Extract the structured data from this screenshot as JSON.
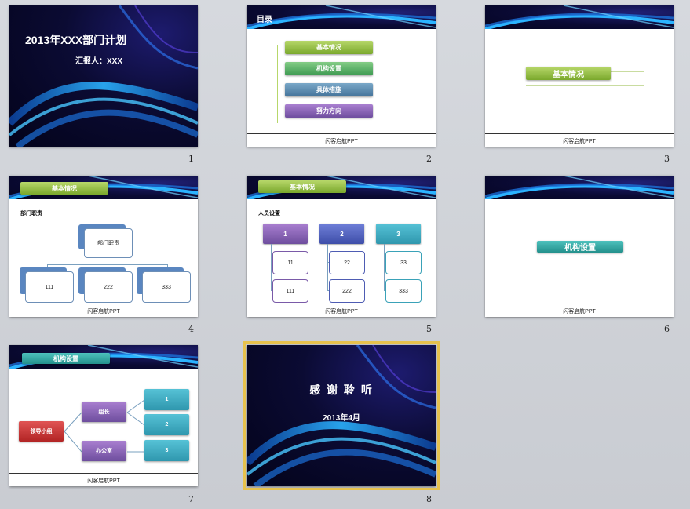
{
  "slides": [
    {
      "number": "1",
      "title": "2013年XXX部门计划",
      "subtitle": "汇报人：XXX"
    },
    {
      "number": "2",
      "title": "目录",
      "items": [
        "基本情况",
        "机构设置",
        "具体措施",
        "努力方向"
      ],
      "footer": "闪客启航PPT"
    },
    {
      "number": "3",
      "section": "基本情况",
      "footer": "闪客启航PPT"
    },
    {
      "number": "4",
      "header": "基本情况",
      "label": "部门职责",
      "root": "部门职责",
      "children": [
        "111",
        "222",
        "333"
      ],
      "footer": "闪客启航PPT"
    },
    {
      "number": "5",
      "header": "基本情况",
      "label": "人员设置",
      "columns": [
        {
          "head": "1",
          "items": [
            "11",
            "111"
          ]
        },
        {
          "head": "2",
          "items": [
            "22",
            "222"
          ]
        },
        {
          "head": "3",
          "items": [
            "33",
            "333"
          ]
        }
      ],
      "footer": "闪客启航PPT"
    },
    {
      "number": "6",
      "section": "机构设置",
      "footer": "闪客启航PPT"
    },
    {
      "number": "7",
      "header": "机构设置",
      "root": "领导小组",
      "mid": [
        "组长",
        "办公室"
      ],
      "leaves": [
        "1",
        "2",
        "3"
      ],
      "footer": "闪客启航PPT"
    },
    {
      "number": "8",
      "title": "感 谢 聆 听",
      "subtitle": "2013年4月"
    }
  ],
  "selected_slide": "8",
  "colors": {
    "selection": "#e7c24d",
    "wave": "#29a8ff"
  }
}
